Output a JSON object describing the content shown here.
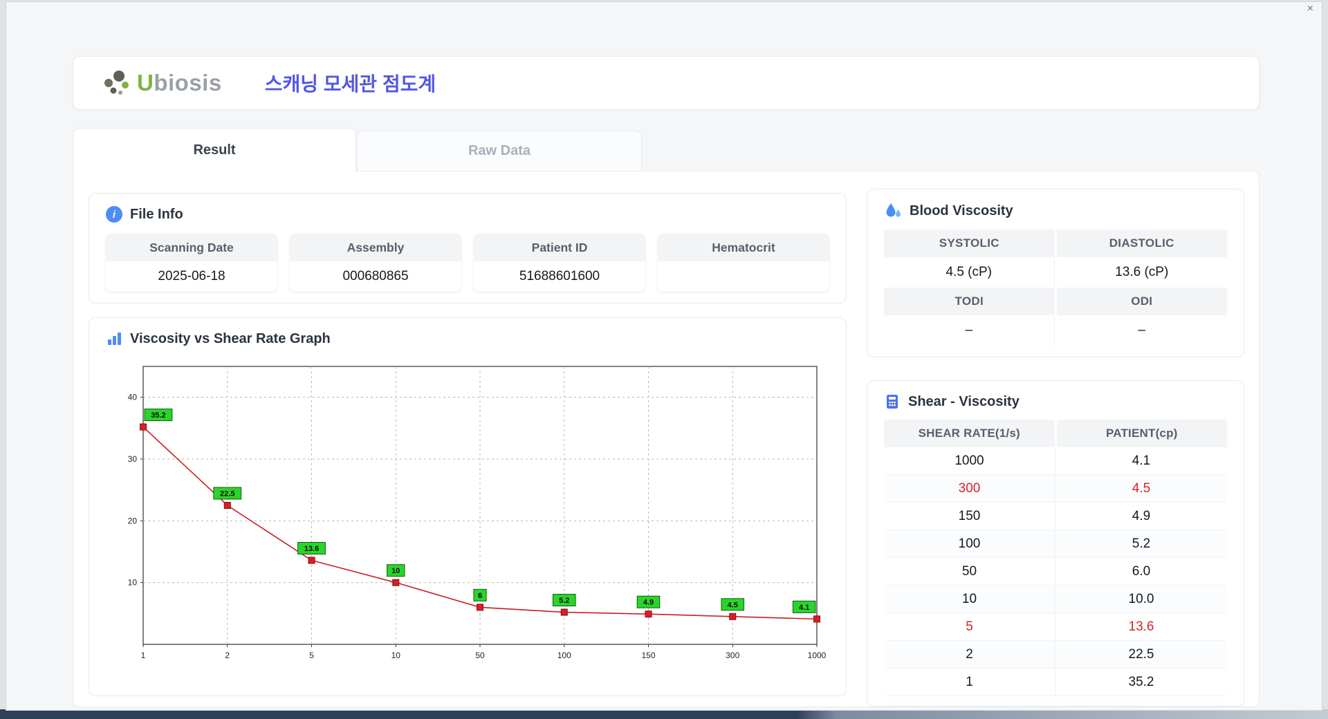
{
  "window": {
    "close_icon": "×"
  },
  "colors": {
    "accent_blue": "#4c8df5",
    "title_indigo": "#5257e5",
    "logo_green": "#7cb342",
    "highlight_red": "#d5232a",
    "chart_line_red": "#c81e25",
    "chart_marker_red": "#e01b24",
    "chart_label_green": "#2bd42b"
  },
  "icons": {
    "logo": "molecule-icon",
    "file_info": "info-icon",
    "graph": "bar-chart-icon",
    "blood": "water-drops-icon",
    "shear": "calculator-icon",
    "close": "close-icon"
  },
  "header": {
    "logo_u": "U",
    "logo_rest": "biosis",
    "title": "스캐닝 모세관 점도계"
  },
  "tabs": [
    {
      "label": "Result",
      "active": true
    },
    {
      "label": "Raw Data",
      "active": false
    }
  ],
  "file_info": {
    "title": "File Info",
    "fields": [
      {
        "label": "Scanning Date",
        "value": "2025-06-18"
      },
      {
        "label": "Assembly",
        "value": "000680865"
      },
      {
        "label": "Patient ID",
        "value": "51688601600"
      },
      {
        "label": "Hematocrit",
        "value": ""
      }
    ]
  },
  "blood_viscosity": {
    "title": "Blood Viscosity",
    "metrics": [
      {
        "label": "SYSTOLIC",
        "value": "4.5 (cP)"
      },
      {
        "label": "DIASTOLIC",
        "value": "13.6 (cP)"
      },
      {
        "label": "TODI",
        "value": "–"
      },
      {
        "label": "ODI",
        "value": "–"
      }
    ]
  },
  "graph_panel": {
    "title": "Viscosity vs Shear Rate Graph"
  },
  "shear_table": {
    "title": "Shear - Viscosity",
    "columns": [
      "SHEAR RATE(1/s)",
      "PATIENT(cp)"
    ],
    "rows": [
      {
        "shear": "1000",
        "patient": "4.1",
        "highlight": false
      },
      {
        "shear": "300",
        "patient": "4.5",
        "highlight": true
      },
      {
        "shear": "150",
        "patient": "4.9",
        "highlight": false
      },
      {
        "shear": "100",
        "patient": "5.2",
        "highlight": false
      },
      {
        "shear": "50",
        "patient": "6.0",
        "highlight": false
      },
      {
        "shear": "10",
        "patient": "10.0",
        "highlight": false
      },
      {
        "shear": "5",
        "patient": "13.6",
        "highlight": true
      },
      {
        "shear": "2",
        "patient": "22.5",
        "highlight": false
      },
      {
        "shear": "1",
        "patient": "35.2",
        "highlight": false
      }
    ]
  },
  "chart_data": {
    "type": "line",
    "title": "Viscosity vs Shear Rate Graph",
    "x_categories": [
      1,
      2,
      5,
      10,
      50,
      100,
      150,
      300,
      1000
    ],
    "values": [
      35.2,
      22.5,
      13.6,
      10,
      6,
      5.2,
      4.9,
      4.5,
      4.1
    ],
    "point_labels": [
      "35.2",
      "22.5",
      "13.6",
      "10",
      "6",
      "5.2",
      "4.9",
      "4.5",
      "4.1"
    ],
    "xlabel": "",
    "ylabel": "",
    "x_scale": "category-evenly-spaced",
    "y_ticks": [
      10,
      20,
      30,
      40
    ],
    "ylim": [
      0,
      45
    ],
    "grid": true,
    "legend": false,
    "line_color": "#c81e25",
    "marker_color": "#e01b24",
    "label_bg": "#2bd42b"
  }
}
